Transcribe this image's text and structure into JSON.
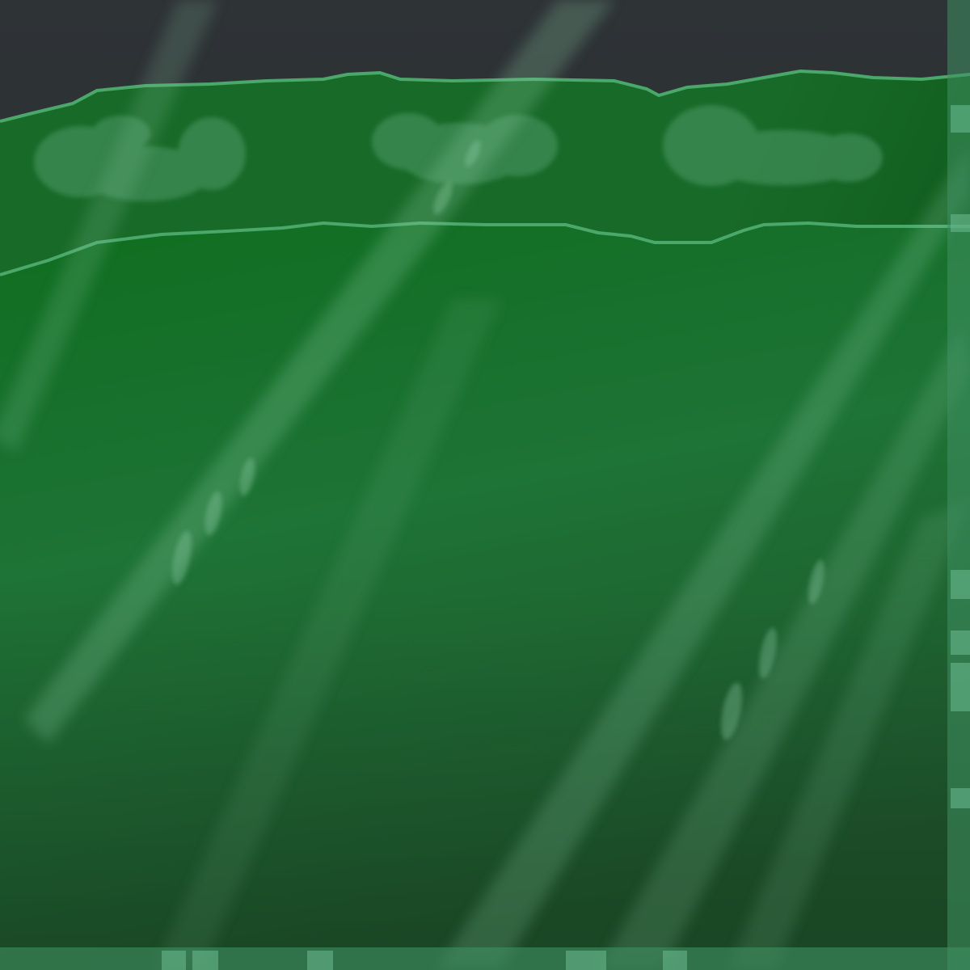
{
  "scene": {
    "kind": "underwater-game-backdrop",
    "ui_text": []
  },
  "palette": {
    "night_sky": "#24282a",
    "night_sky_top": "#2e3336",
    "far_hill": "#186a28",
    "far_hill_dark": "#0f5a1c",
    "near_ground": "#0f6e1f",
    "near_ground_mid": "#1e7336",
    "near_ground_deep": "#1f552c",
    "ridge_outline": "#4aa86a",
    "bush_tint": "#4e9a68",
    "light_ray": "#8fcfa8",
    "right_frame": "#3f8f63",
    "frame_tile": "#6ebd93"
  },
  "icons": {
    "far-hills": "layered-hill-silhouette",
    "bushes": "soft-blob-shrubs",
    "light-rays": "diagonal-sunbeam-streaks",
    "bubbles": "faint-rising-bubbles",
    "border-tiles": "pale-green-tile-strip"
  }
}
